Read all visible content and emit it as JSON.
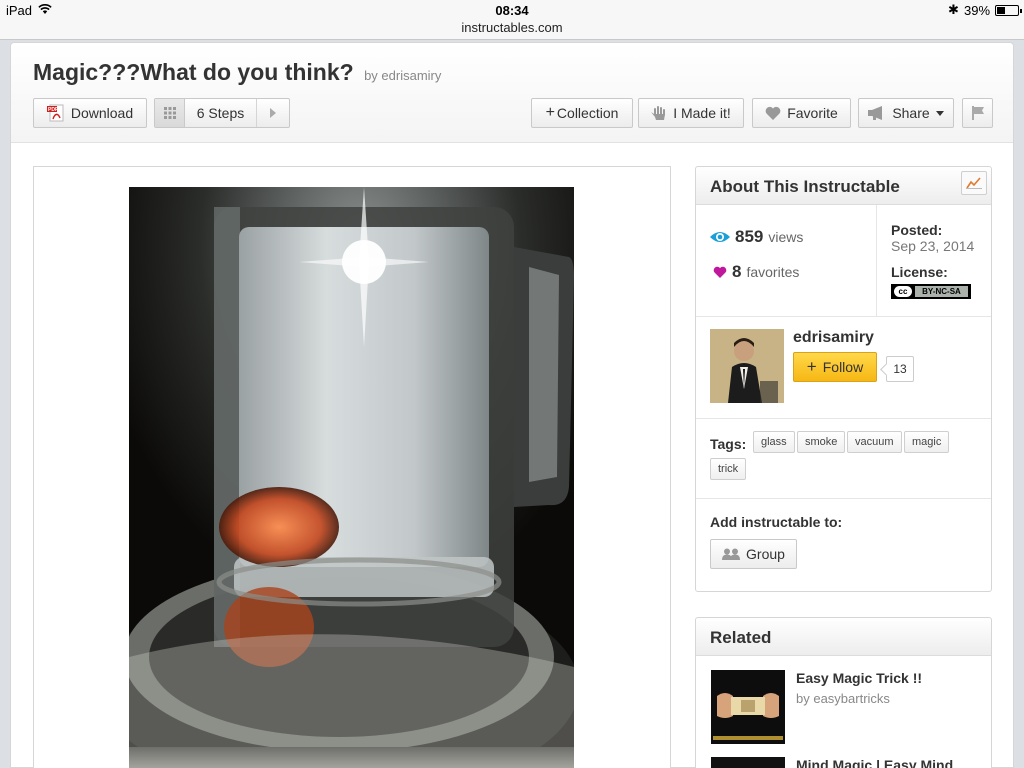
{
  "status_bar": {
    "device": "iPad",
    "time": "08:34",
    "url": "instructables.com",
    "battery": "39%"
  },
  "header": {
    "title": "Magic???What do you think?",
    "byline": "by edrisamiry",
    "download_label": "Download",
    "steps_label": "6 Steps",
    "collection_label": "Collection",
    "made_it_label": "I Made it!",
    "favorite_label": "Favorite",
    "share_label": "Share"
  },
  "about": {
    "heading": "About This Instructable",
    "views_count": "859",
    "views_unit": "views",
    "favorites_count": "8",
    "favorites_unit": "favorites",
    "posted_label": "Posted:",
    "posted_date": "Sep 23, 2014",
    "license_label": "License:",
    "license_badge": "BY-NC-SA",
    "author_name": "edrisamiry",
    "follow_label": "Follow",
    "followers": "13",
    "tags_label": "Tags:",
    "tags": [
      "glass",
      "smoke",
      "vacuum",
      "magic",
      "trick"
    ],
    "add_label": "Add instructable to:",
    "group_label": "Group"
  },
  "related": {
    "heading": "Related",
    "items": [
      {
        "title": "Easy Magic Trick !!",
        "by": "by easybartricks"
      },
      {
        "title": "Mind Magic | Easy Mind",
        "by": ""
      }
    ]
  },
  "colors": {
    "follow_accent": "#f6b713",
    "views_icon": "#1b9fd8",
    "favorites_icon": "#c0189c"
  }
}
